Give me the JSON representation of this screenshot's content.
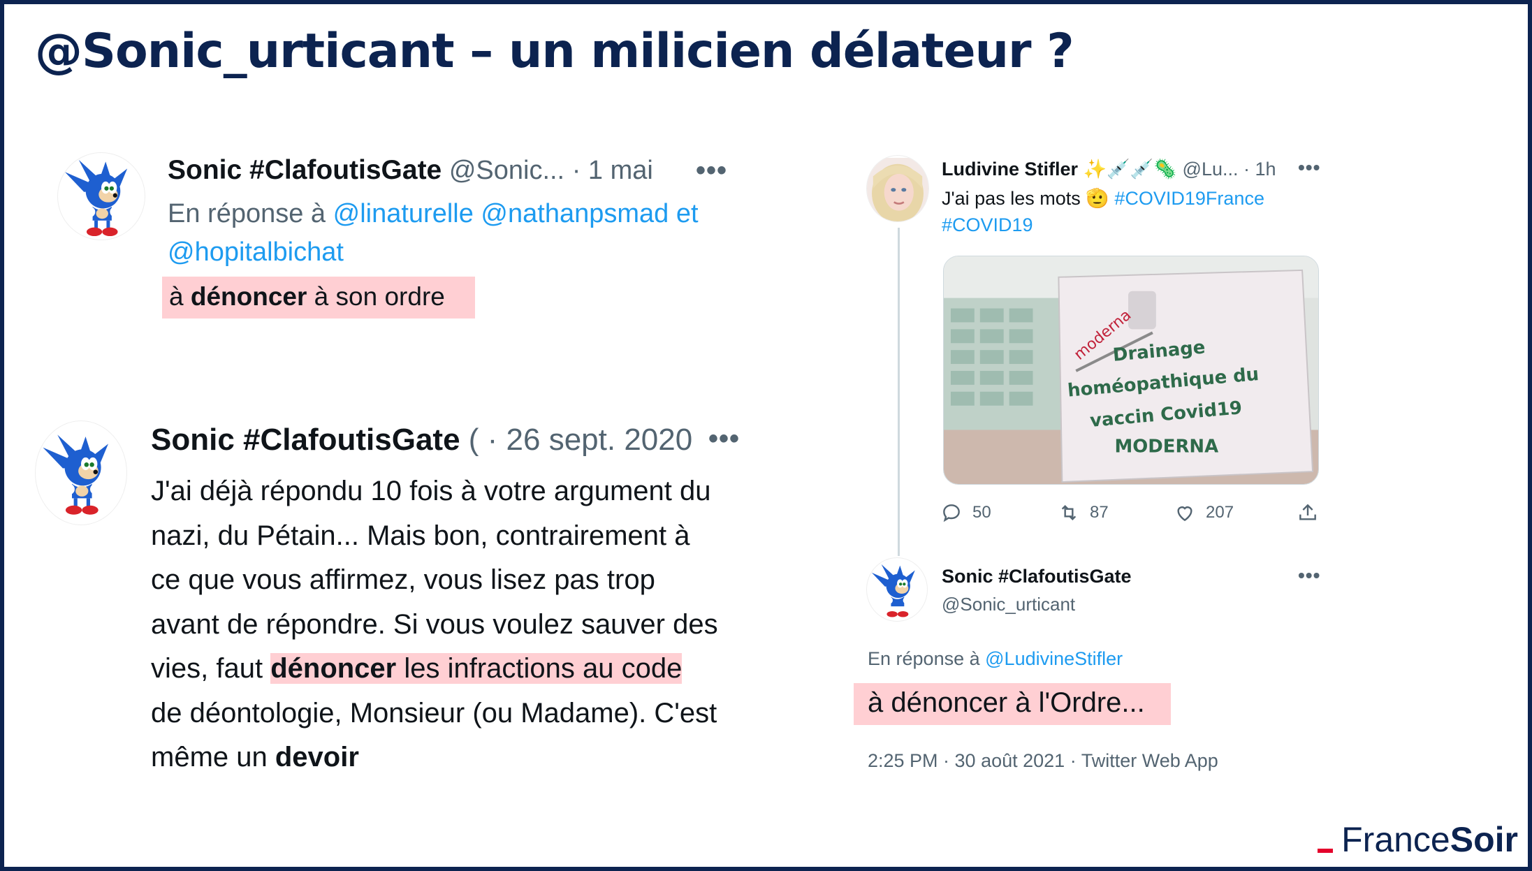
{
  "slide": {
    "title": "@Sonic_urticant – un milicien délateur ?"
  },
  "tweet1": {
    "name": "Sonic #ClafoutisGate",
    "handle": "@Sonic...",
    "time": "· 1 mai",
    "more": "•••",
    "reply_prefix": "En réponse à",
    "mention1": "@linaturelle",
    "mention2": "@nathanpsmad",
    "reply_and": "et",
    "mention3": "@hopitalbichat",
    "body_a": "à ",
    "body_b": "dénoncer",
    "body_c": " à son ordre"
  },
  "tweet2": {
    "name": "Sonic #ClafoutisGate",
    "handle_cut": "(",
    "time": "· 26 sept. 2020",
    "more": "•••",
    "line1": "J'ai déjà répondu 10 fois à votre argument du",
    "line2": "nazi, du Pétain... Mais bon, contrairement à",
    "line3": "ce que vous affirmez, vous lisez pas trop",
    "line4": "avant de répondre. Si vous voulez sauver des",
    "line5_a": "vies, faut ",
    "line5_b": "dénoncer",
    "line5_c": " les infractions au code",
    "line6": "de déontologie, Monsieur (ou Madame). C'est",
    "line7_a": "même un ",
    "line7_b": "devoir"
  },
  "tweet3": {
    "name": "Ludivine Stifler",
    "emojis": "✨💉💉🦠",
    "handle": "@Lu...",
    "time": "· 1h",
    "more": "•••",
    "text": "J'ai pas les mots 🫡",
    "tag1": "#COVID19France",
    "tag2": "#COVID19",
    "photo_brand": "moderna",
    "photo_sign": [
      "Drainage",
      "homéopathique du",
      "vaccin Covid19",
      "MODERNA"
    ],
    "replies": "50",
    "retweets": "87",
    "likes": "207"
  },
  "tweet4": {
    "name": "Sonic #ClafoutisGate",
    "handle": "@Sonic_urticant",
    "more": "•••",
    "reply_prefix": "En réponse à",
    "mention": "@LudivineStifler",
    "body": "à dénoncer à l'Ordre...",
    "meta": "2:25 PM · 30 août 2021 · Twitter Web App"
  },
  "brand": {
    "part1": "France",
    "part2": "Soir"
  },
  "colors": {
    "title": "#0c2350",
    "link": "#1d9bf0",
    "highlight": "#ffcfd3",
    "brand_red": "#e4002b"
  }
}
